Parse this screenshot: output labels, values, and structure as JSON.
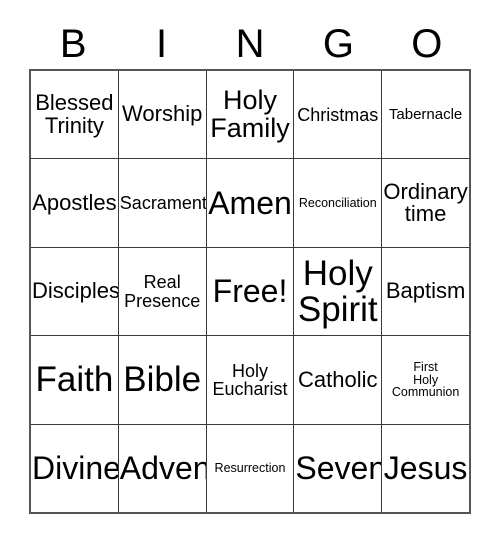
{
  "card": {
    "title": "BINGO Card",
    "header_letters": [
      "B",
      "I",
      "N",
      "G",
      "O"
    ],
    "colors": {
      "background": "#ffffff",
      "text": "#000000",
      "grid_line": "#3a3a3a",
      "grid_outer_border": "#555555"
    },
    "grid": {
      "columns": 5,
      "rows": 5,
      "cells": [
        [
          {
            "label": "Blessed\nTrinity",
            "size": "md",
            "free_space": false
          },
          {
            "label": "Worship",
            "size": "md",
            "free_space": false
          },
          {
            "label": "Holy\nFamily",
            "size": "lg",
            "free_space": false
          },
          {
            "label": "Christmas",
            "size": "sm",
            "free_space": false
          },
          {
            "label": "Tabernacle",
            "size": "xs",
            "free_space": false
          }
        ],
        [
          {
            "label": "Apostles",
            "size": "md",
            "free_space": false
          },
          {
            "label": "Sacrament",
            "size": "sm",
            "free_space": false
          },
          {
            "label": "Amen",
            "size": "xl",
            "free_space": false
          },
          {
            "label": "Reconciliation",
            "size": "xxs",
            "free_space": false
          },
          {
            "label": "Ordinary\ntime",
            "size": "md",
            "free_space": false
          }
        ],
        [
          {
            "label": "Disciples",
            "size": "md",
            "free_space": false
          },
          {
            "label": "Real\nPresence",
            "size": "sm",
            "free_space": false
          },
          {
            "label": "Free!",
            "size": "xl",
            "free_space": true
          },
          {
            "label": "Holy\nSpirit",
            "size": "xxl",
            "free_space": false
          },
          {
            "label": "Baptism",
            "size": "md",
            "free_space": false
          }
        ],
        [
          {
            "label": "Faith",
            "size": "xxl",
            "free_space": false
          },
          {
            "label": "Bible",
            "size": "xxl",
            "free_space": false
          },
          {
            "label": "Holy\nEucharist",
            "size": "sm",
            "free_space": false
          },
          {
            "label": "Catholic",
            "size": "md",
            "free_space": false
          },
          {
            "label": "First\nHoly\nCommunion",
            "size": "xxs",
            "free_space": false
          }
        ],
        [
          {
            "label": "Divine",
            "size": "xl",
            "free_space": false
          },
          {
            "label": "Advent",
            "size": "xl",
            "free_space": false
          },
          {
            "label": "Resurrection",
            "size": "xxs",
            "free_space": false
          },
          {
            "label": "Seven",
            "size": "xl",
            "free_space": false
          },
          {
            "label": "Jesus",
            "size": "xl",
            "free_space": false
          }
        ]
      ]
    }
  }
}
